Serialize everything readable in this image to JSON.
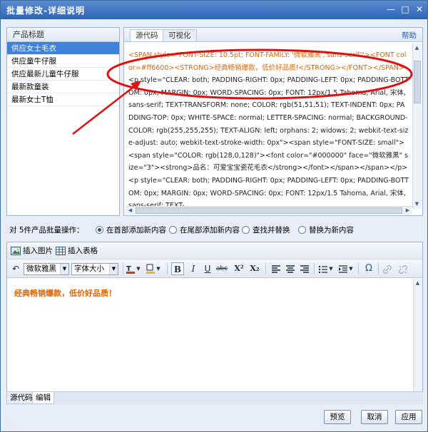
{
  "window": {
    "title": "批量修改-详细说明",
    "icons": [
      "close-icon",
      "maximize-icon",
      "minimize-icon"
    ]
  },
  "products": {
    "header": "产品标题",
    "items": [
      {
        "label": "供应女士毛衣",
        "selected": true
      },
      {
        "label": "供应童牛仔服",
        "selected": false
      },
      {
        "label": "供应最新儿童牛仔服",
        "selected": false
      },
      {
        "label": "最新款童装",
        "selected": false
      },
      {
        "label": "最新女士T恤",
        "selected": false
      }
    ]
  },
  "source_panel": {
    "tabs": [
      "源代码",
      "可视化"
    ],
    "active_tab": "源代码",
    "help": "帮助",
    "code_highlight": "<SPAN style=\"FONT-SIZE: 10.5pt; FONT-FAMILY: '微软雅黑','sans-serif'\"><FONT color=#ff6600><STRONG>经典畅销爆款，低价好品质!</STRONG></FONT></SPAN>",
    "code_rest": "<p style=\"CLEAR: both; PADDING-RIGHT: 0px; PADDING-LEFT: 0px; PADDING-BOTTOM: 0px; MARGIN: 0px; WORD-SPACING: 0px; FONT: 12px/1.5 Tahoma, Arial, 宋体, sans-serif; TEXT-TRANSFORM: none; COLOR: rgb(51,51,51); TEXT-INDENT: 0px; PADDING-TOP: 0px; WHITE-SPACE: normal; LETTER-SPACING: normal; BACKGROUND-COLOR: rgb(255,255,255); TEXT-ALIGN: left; orphans: 2; widows: 2; webkit-text-size-adjust: auto; webkit-text-stroke-width: 0px\"><span style=\"FONT-SIZE: small\"><span style=\"COLOR: rgb(128,0,128)\"><font color=\"#000000\" face=\"微软雅黑\" size=\"3\"><strong>品名：可爱宝宝瓷花毛衣</strong></font></span></span></p><p style=\"CLEAR: both; PADDING-RIGHT: 0px; PADDING-LEFT: 0px; PADDING-BOTTOM: 0px; MARGIN: 0px; WORD-SPACING: 0px; FONT: 12px/1.5 Tahoma, Arial, 宋体, sans-serif; TEXT-"
  },
  "batch": {
    "label": "对 5件产品批量操作：",
    "options": [
      {
        "label": "在首部添加新内容",
        "checked": true
      },
      {
        "label": "在尾部添加新内容",
        "checked": false
      },
      {
        "label": "查找并替换",
        "checked": false
      },
      {
        "label": "替换为新内容",
        "checked": false
      }
    ]
  },
  "editor": {
    "insert_image": "插入图片",
    "insert_table": "插入表格",
    "font_family": "微软雅黑",
    "font_size": "字体大小",
    "format_buttons": [
      "B",
      "I",
      "U",
      "abc",
      "X²",
      "X₂"
    ],
    "omega": "Ω",
    "content": "经典畅销爆款，低价好品质！",
    "accent_color": "#e06400"
  },
  "bottom_tabs": [
    "源代码",
    "编辑"
  ],
  "buttons": {
    "preview": "预览",
    "cancel": "取消",
    "apply": "应用"
  }
}
